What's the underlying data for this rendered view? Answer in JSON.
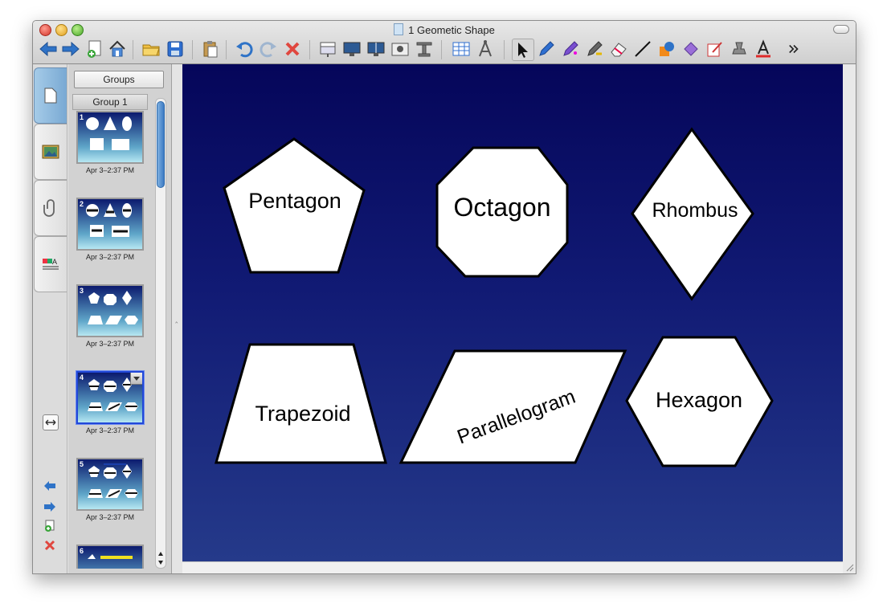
{
  "window": {
    "title": "1 Geometic Shape"
  },
  "sorter": {
    "groups_button": "Groups",
    "group_label": "Group 1",
    "pages": [
      {
        "number": "1",
        "date": "Apr 3–2:37 PM"
      },
      {
        "number": "2",
        "date": "Apr 3–2:37 PM"
      },
      {
        "number": "3",
        "date": "Apr 3–2:37 PM"
      },
      {
        "number": "4",
        "date": "Apr 3–2:37 PM"
      },
      {
        "number": "5",
        "date": "Apr 3–2:37 PM"
      },
      {
        "number": "6",
        "date": ""
      }
    ]
  },
  "canvas": {
    "shapes": {
      "pentagon": "Pentagon",
      "octagon": "Octagon",
      "rhombus": "Rhombus",
      "trapezoid": "Trapezoid",
      "parallelogram": "Parallelogram",
      "hexagon": "Hexagon"
    }
  },
  "toolbar": {
    "icons": [
      "back-arrow-icon",
      "forward-arrow-icon",
      "blank-page-icon",
      "home-icon",
      "open-folder-icon",
      "save-icon",
      "paste-icon",
      "undo-icon",
      "redo-icon",
      "delete-icon",
      "screen-shade-icon",
      "display-icon",
      "dual-display-icon",
      "screen-capture-icon",
      "document-camera-icon",
      "table-icon",
      "measurement-tools-icon",
      "select-icon",
      "pen-icon",
      "creative-pen-icon",
      "magic-pen-icon",
      "eraser-icon",
      "line-icon",
      "shape-icon",
      "fill-icon",
      "properties-icon",
      "capture-icon",
      "text-icon",
      "more-chevron-icon"
    ]
  },
  "colors": {
    "canvas_top": "#05065a",
    "canvas_bottom": "#253a8a",
    "accent_blue": "#3d7bc4"
  }
}
